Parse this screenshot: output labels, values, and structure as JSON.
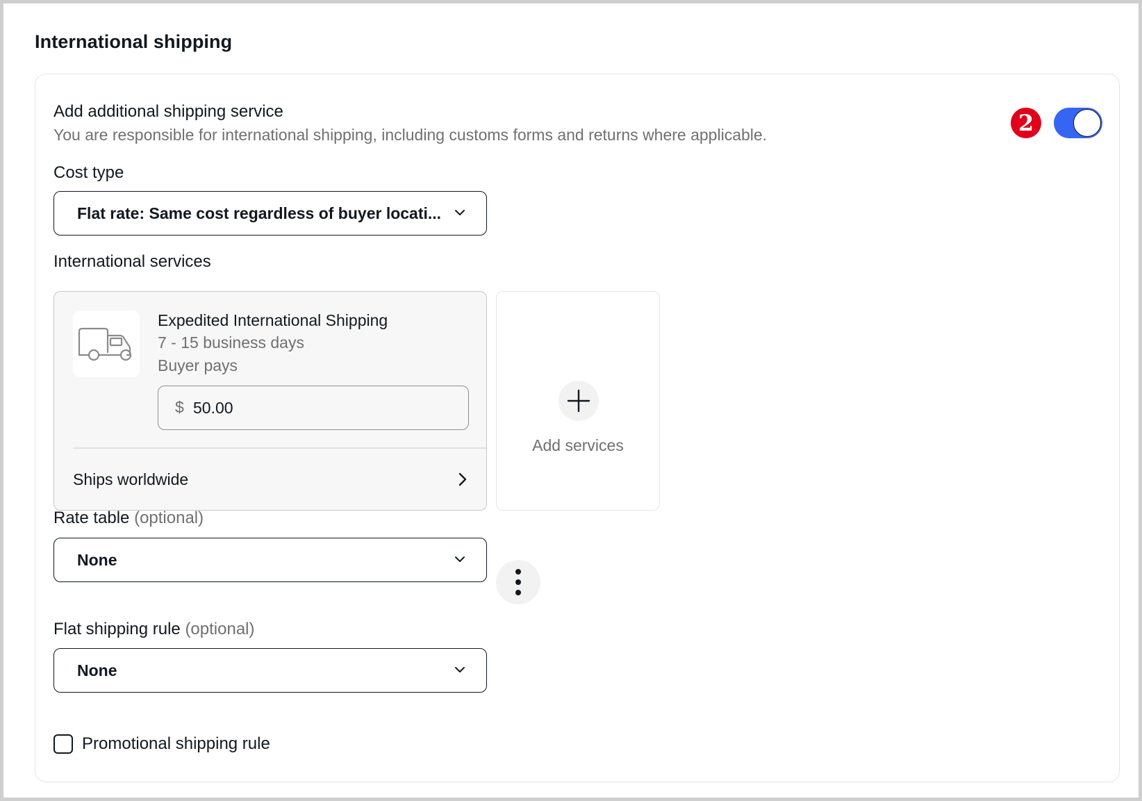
{
  "section": {
    "title": "International shipping"
  },
  "service_toggle": {
    "title": "Add additional shipping service",
    "description": "You are responsible for international shipping, including customs forms and returns where applicable.",
    "badge": "2",
    "enabled": true
  },
  "cost_type": {
    "label": "Cost type",
    "value": "Flat rate: Same cost regardless of buyer locati..."
  },
  "services": {
    "label": "International services",
    "items": [
      {
        "name": "Expedited International Shipping",
        "days": "7 - 15 business days",
        "payer": "Buyer pays",
        "currency": "$",
        "price": "50.00",
        "destination": "Ships worldwide"
      }
    ],
    "add_label": "Add services"
  },
  "rate_table": {
    "label": "Rate table",
    "optional": "(optional)",
    "value": "None"
  },
  "flat_rule": {
    "label": "Flat shipping rule",
    "optional": "(optional)",
    "value": "None"
  },
  "promo_rule": {
    "label": "Promotional shipping rule",
    "checked": false
  },
  "colors": {
    "toggle_on": "#3665f3",
    "badge": "#e0001b",
    "muted_text": "#707070",
    "text": "#111820"
  }
}
